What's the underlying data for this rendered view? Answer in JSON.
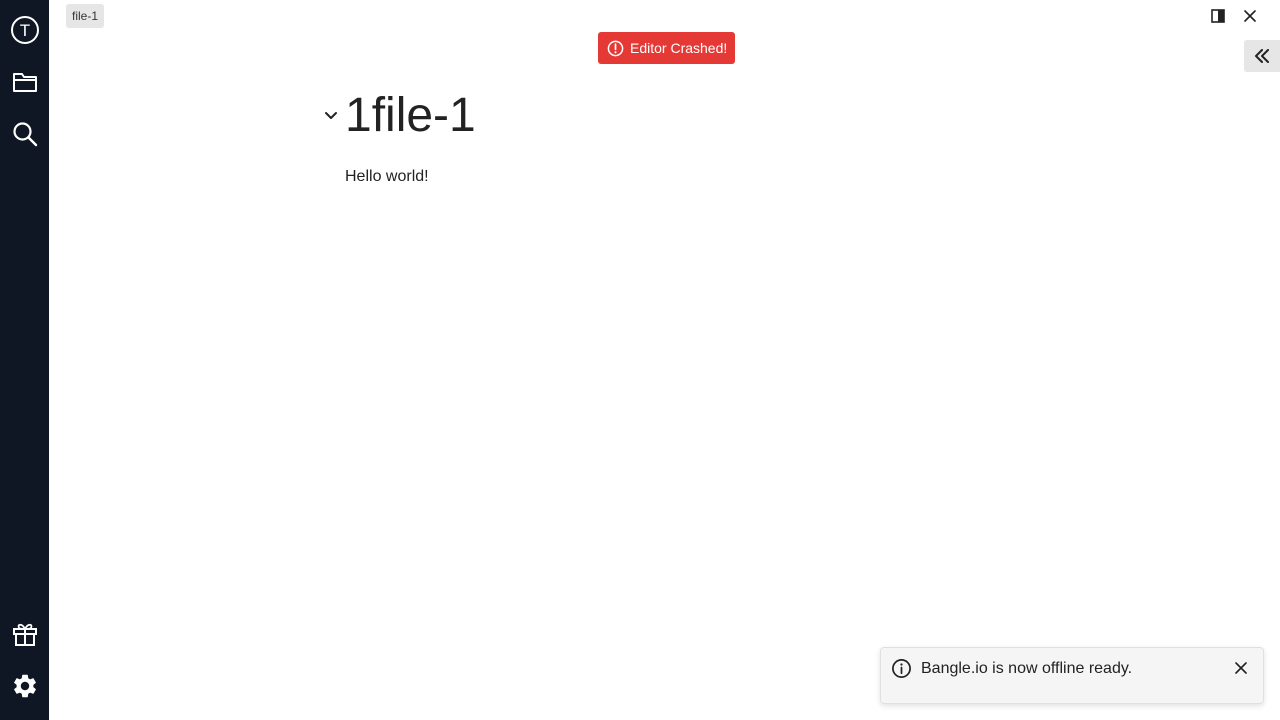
{
  "activity_bar": {
    "logo_letter": "T",
    "items": [
      {
        "icon": "workspace-logo-icon"
      },
      {
        "icon": "folder-icon"
      },
      {
        "icon": "search-icon"
      },
      {
        "icon": "gift-icon"
      },
      {
        "icon": "gear-icon"
      }
    ],
    "background": "#0f1724"
  },
  "tab": {
    "label": "file-1"
  },
  "status": {
    "crash_label": "Editor Crashed!",
    "crash_color": "#e53935"
  },
  "window_controls": {
    "split_icon": "split-view-icon",
    "close_icon": "close-icon"
  },
  "sidebar_toggle": {
    "icon": "double-chevron-left-icon"
  },
  "document": {
    "heading": "1file-1",
    "paragraph": "Hello world!"
  },
  "toast": {
    "message": "Bangle.io is now offline ready.",
    "icon": "info-icon"
  }
}
